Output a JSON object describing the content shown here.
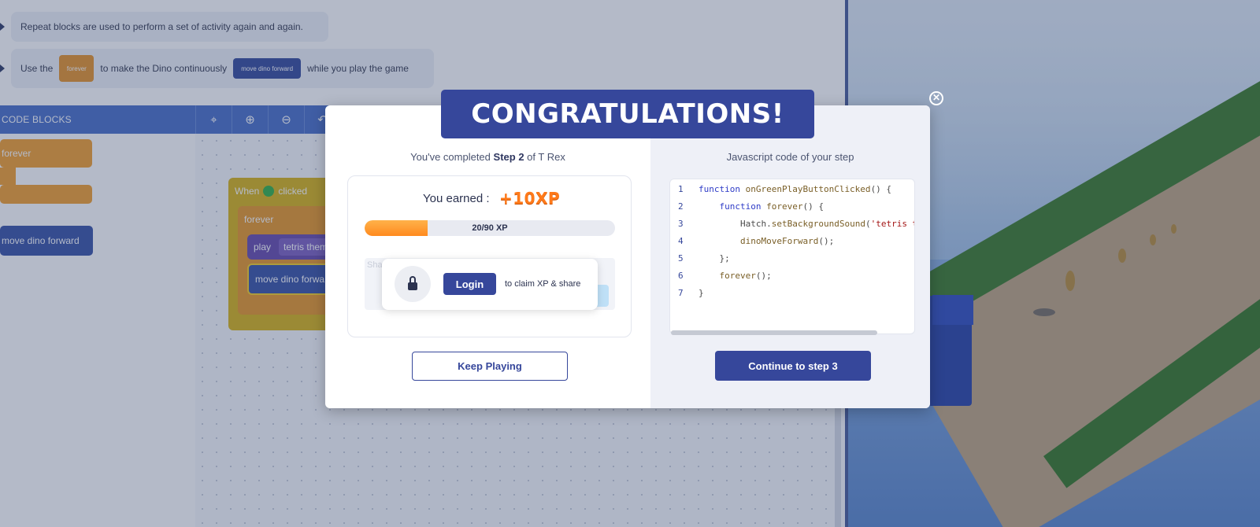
{
  "instructions": {
    "line1": "Repeat blocks are used to perform a set of activity again and again.",
    "line2_prefix": "Use the",
    "line2_chip1": "forever",
    "line2_mid": "to make the Dino continuously",
    "line2_chip2": "move dino forward",
    "line2_suffix": "while you play the game"
  },
  "code_blocks": {
    "header": "CODE BLOCKS",
    "palette": [
      "forever",
      "move dino forward"
    ],
    "workspace": {
      "when_clicked_prefix": "When",
      "when_clicked_suffix": "clicked",
      "forever": "forever",
      "play": "play",
      "play_arg": "tetris them",
      "move": "move dino forwa"
    }
  },
  "modal": {
    "banner": "CONGRATULATIONS!",
    "completed_prefix": "You've completed",
    "completed_step": "Step 2",
    "completed_suffix": "of T Rex",
    "earned_label": "You earned :",
    "xp_badge": "+10XP",
    "xp_text": "20/90 XP",
    "xp_progress": 0.25,
    "share_label": "Sha",
    "login_button": "Login",
    "claim_text": "to claim XP & share",
    "keep_playing": "Keep Playing",
    "code_title": "Javascript code of your step",
    "continue_button": "Continue to step 3",
    "close_icon": "close-icon"
  },
  "code": [
    {
      "n": "1",
      "indent": "",
      "parts": [
        [
          "kw",
          "function "
        ],
        [
          "fn",
          "onGreenPlayButtonClicked"
        ],
        [
          "pl",
          "() {"
        ]
      ]
    },
    {
      "n": "2",
      "indent": "    ",
      "parts": [
        [
          "kw",
          "function "
        ],
        [
          "fn",
          "forever"
        ],
        [
          "pl",
          "() {"
        ]
      ]
    },
    {
      "n": "3",
      "indent": "        ",
      "parts": [
        [
          "pl",
          "Hatch."
        ],
        [
          "fn",
          "setBackgroundSound"
        ],
        [
          "pl",
          "("
        ],
        [
          "str",
          "'tetris t"
        ]
      ]
    },
    {
      "n": "4",
      "indent": "        ",
      "parts": [
        [
          "fn",
          "dinoMoveForward"
        ],
        [
          "pl",
          "();"
        ]
      ]
    },
    {
      "n": "5",
      "indent": "    ",
      "parts": [
        [
          "pl",
          "};"
        ]
      ]
    },
    {
      "n": "6",
      "indent": "    ",
      "parts": [
        [
          "fn",
          "forever"
        ],
        [
          "pl",
          "();"
        ]
      ]
    },
    {
      "n": "7",
      "indent": "",
      "parts": [
        [
          "pl",
          "}"
        ]
      ]
    }
  ],
  "colors": {
    "primary": "#36479b",
    "accent_orange": "#ff8a1f",
    "block_orange": "#f3a133",
    "block_blue": "#3d56a8"
  }
}
